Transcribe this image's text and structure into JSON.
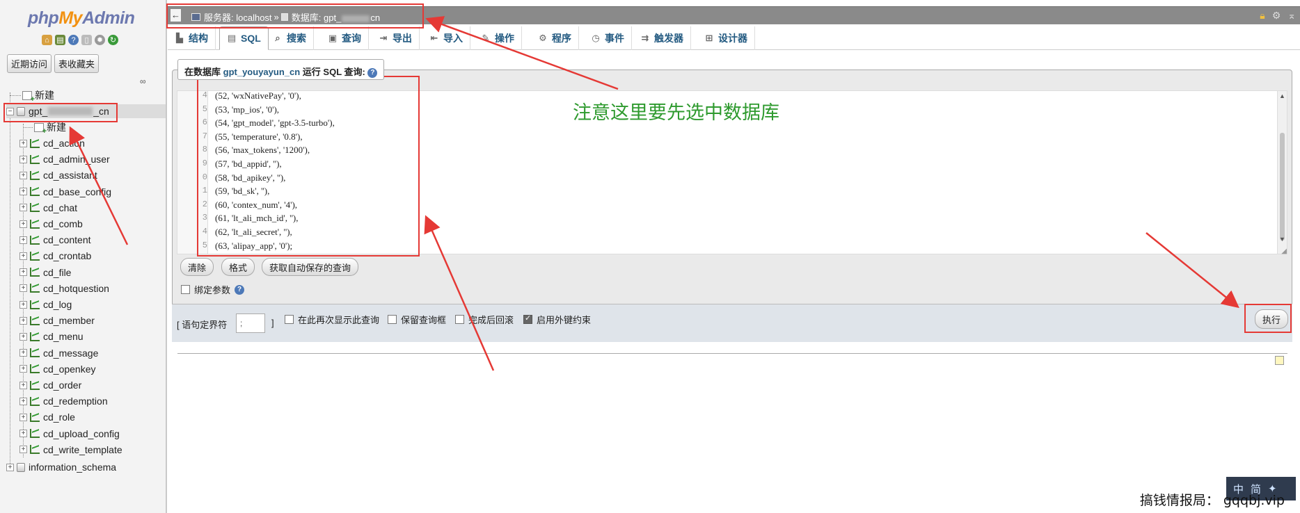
{
  "logo": {
    "php": "php",
    "my": "My",
    "admin": "Admin"
  },
  "nav_tabs": [
    "近期访问",
    "表收藏夹"
  ],
  "tree": {
    "new_label": "新建",
    "db_prefix": "gpt_",
    "db_suffix": "_cn",
    "db_new_label": "新建",
    "tables": [
      "cd_action",
      "cd_admin_user",
      "cd_assistant",
      "cd_base_config",
      "cd_chat",
      "cd_comb",
      "cd_content",
      "cd_crontab",
      "cd_file",
      "cd_hotquestion",
      "cd_log",
      "cd_member",
      "cd_menu",
      "cd_message",
      "cd_openkey",
      "cd_order",
      "cd_redemption",
      "cd_role",
      "cd_upload_config",
      "cd_write_template"
    ],
    "other_db": "information_schema"
  },
  "breadcrumb": {
    "server": "服务器: localhost",
    "sep": "»",
    "db_prefix": "数据库: gpt_",
    "db_suffix": "cn"
  },
  "tabs": [
    {
      "label": "结构",
      "icon": "structure-icon"
    },
    {
      "label": "SQL",
      "icon": "sql-icon"
    },
    {
      "label": "搜索",
      "icon": "search-icon"
    },
    {
      "label": "查询",
      "icon": "query-icon"
    },
    {
      "label": "导出",
      "icon": "export-icon"
    },
    {
      "label": "导入",
      "icon": "import-icon"
    },
    {
      "label": "操作",
      "icon": "operations-icon"
    },
    {
      "label": "程序",
      "icon": "routines-icon"
    },
    {
      "label": "事件",
      "icon": "events-icon"
    },
    {
      "label": "触发器",
      "icon": "triggers-icon"
    },
    {
      "label": "设计器",
      "icon": "designer-icon"
    }
  ],
  "sql_panel": {
    "legend_prefix": "在数据库",
    "legend_db": "gpt_youyayun_cn",
    "legend_suffix": "运行 SQL 查询:",
    "code_lines": [
      {
        "ln": "4",
        "code": "(52, 'wxNativePay', '0'),"
      },
      {
        "ln": "5",
        "code": "(53, 'mp_ios', '0'),"
      },
      {
        "ln": "6",
        "code": "(54, 'gpt_model', 'gpt-3.5-turbo'),"
      },
      {
        "ln": "7",
        "code": "(55, 'temperature', '0.8'),"
      },
      {
        "ln": "8",
        "code": "(56, 'max_tokens', '1200'),"
      },
      {
        "ln": "9",
        "code": "(57, 'bd_appid', ''),"
      },
      {
        "ln": "0",
        "code": "(58, 'bd_apikey', ''),"
      },
      {
        "ln": "1",
        "code": "(59, 'bd_sk', ''),"
      },
      {
        "ln": "2",
        "code": "(60, 'contex_num', '4'),"
      },
      {
        "ln": "3",
        "code": "(61, 'lt_ali_mch_id', ''),"
      },
      {
        "ln": "4",
        "code": "(62, 'lt_ali_secret', ''),"
      },
      {
        "ln": "5",
        "code": "(63, 'alipay_app', '0');"
      }
    ],
    "buttons": {
      "clear": "清除",
      "format": "格式",
      "autosave": "获取自动保存的查询"
    },
    "bind_params": "绑定参数",
    "delimiter_label_open": "[ 语句定界符",
    "delimiter_value": ";",
    "delimiter_label_close": "]",
    "opt_show_again": "在此再次显示此查询",
    "opt_keep_box": "保留查询框",
    "opt_rollback": "完成后回滚",
    "opt_fk": "启用外键约束",
    "opt_fk_checked": true,
    "go_button": "执行"
  },
  "annotation": "注意这里要先选中数据库",
  "watermark": "搞钱情报局： gqqbj.vip",
  "ime": {
    "a": "中",
    "b": "简"
  },
  "colors": {
    "accent_red": "#e53935",
    "annotation_green": "#2e9a2e",
    "link_blue": "#235a81"
  }
}
